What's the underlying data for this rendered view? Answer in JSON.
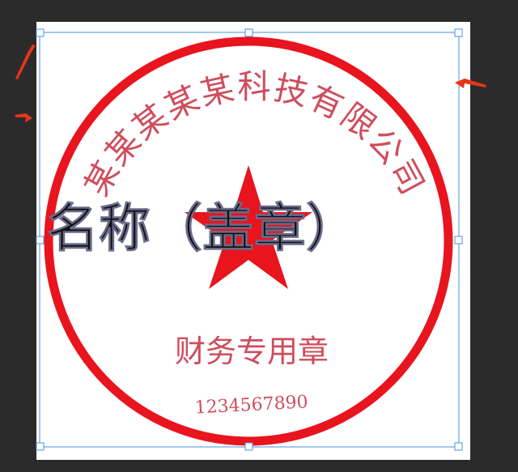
{
  "stamp": {
    "company_name": "某某某某某科技有限公司",
    "department": "财务专用章",
    "code": "1234567890"
  },
  "overlay": {
    "caption": "名称（盖章）"
  },
  "colors": {
    "workspace_background": "#2b2b2b",
    "document_background": "#ffffff",
    "stamp_red": "#e8141e",
    "stamp_text": "#c93a4b",
    "overlay_text": "#111111",
    "selection_border": "#4a90e2",
    "annotation_arrow": "#e8341c"
  },
  "icons": {
    "star": "five-pointed-star-icon",
    "arrows": "annotation-arrow-icon"
  }
}
